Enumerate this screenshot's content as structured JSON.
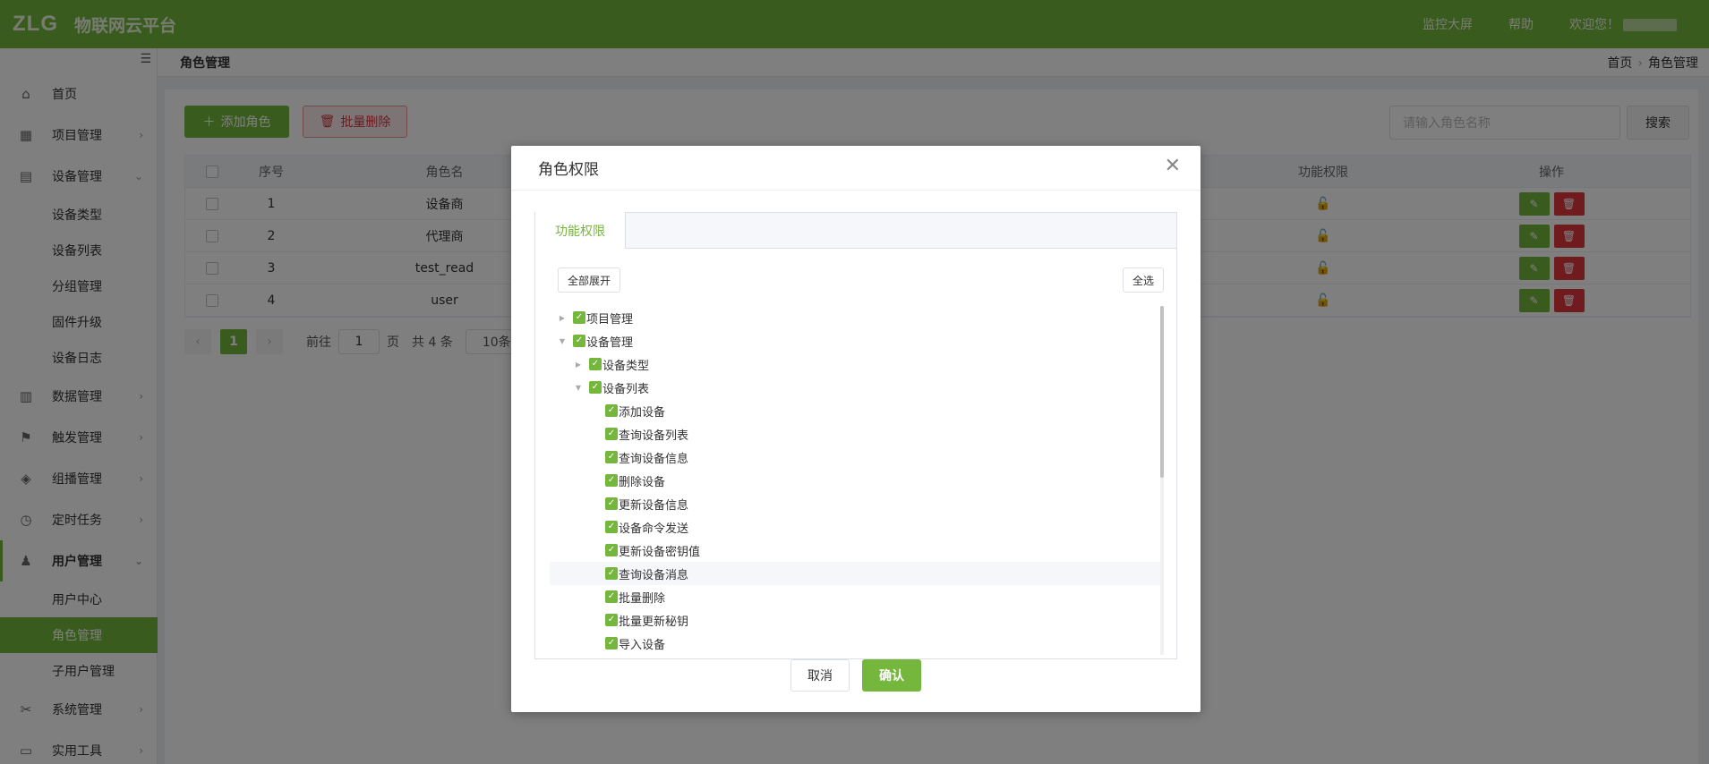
{
  "header": {
    "logo": "ZLG",
    "brand": "物联网云平台",
    "links": [
      "监控大屏",
      "帮助"
    ],
    "welcome": "欢迎您！"
  },
  "sidebar": {
    "items": [
      {
        "label": "首页",
        "icon": "home-icon"
      },
      {
        "label": "项目管理",
        "icon": "dashboard-icon"
      },
      {
        "label": "设备管理",
        "icon": "device-icon",
        "children": [
          "设备类型",
          "设备列表",
          "分组管理",
          "固件升级",
          "设备日志"
        ]
      },
      {
        "label": "数据管理",
        "icon": "chart-icon"
      },
      {
        "label": "触发管理",
        "icon": "flag-icon"
      },
      {
        "label": "组播管理",
        "icon": "layers-icon"
      },
      {
        "label": "定时任务",
        "icon": "clock-icon"
      },
      {
        "label": "用户管理",
        "icon": "user-icon",
        "children": [
          "用户中心",
          "角色管理",
          "子用户管理"
        ]
      },
      {
        "label": "系统管理",
        "icon": "tools-icon"
      },
      {
        "label": "实用工具",
        "icon": "toolbox-icon"
      }
    ]
  },
  "breadcrumb": {
    "title": "角色管理",
    "home": "首页",
    "current": "角色管理"
  },
  "toolbar": {
    "add_label": "添加角色",
    "batch_delete_label": "批量删除",
    "search_placeholder": "请输入角色名称",
    "search_label": "搜索"
  },
  "table": {
    "headers": {
      "no": "序号",
      "name": "角色名",
      "perm": "功能权限",
      "op": "操作"
    },
    "rows": [
      {
        "no": "1",
        "name": "设备商"
      },
      {
        "no": "2",
        "name": "代理商"
      },
      {
        "no": "3",
        "name": "test_read"
      },
      {
        "no": "4",
        "name": "user"
      }
    ]
  },
  "pager": {
    "current": "1",
    "goto_prefix": "前往",
    "goto_value": "1",
    "goto_suffix": "页",
    "total": "共 4 条",
    "size": "10条"
  },
  "dialog": {
    "title": "角色权限",
    "tab": "功能权限",
    "expand_all": "全部展开",
    "select_all": "全选",
    "cancel": "取消",
    "confirm": "确认",
    "tree": [
      {
        "label": "项目管理",
        "level": 0,
        "caret": "right"
      },
      {
        "label": "设备管理",
        "level": 0,
        "caret": "down"
      },
      {
        "label": "设备类型",
        "level": 1,
        "caret": "right"
      },
      {
        "label": "设备列表",
        "level": 1,
        "caret": "down"
      },
      {
        "label": "添加设备",
        "level": 2
      },
      {
        "label": "查询设备列表",
        "level": 2
      },
      {
        "label": "查询设备信息",
        "level": 2
      },
      {
        "label": "删除设备",
        "level": 2
      },
      {
        "label": "更新设备信息",
        "level": 2
      },
      {
        "label": "设备命令发送",
        "level": 2
      },
      {
        "label": "更新设备密钥值",
        "level": 2
      },
      {
        "label": "查询设备消息",
        "level": 2,
        "highlight": true
      },
      {
        "label": "批量删除",
        "level": 2
      },
      {
        "label": "批量更新秘钥",
        "level": 2
      },
      {
        "label": "导入设备",
        "level": 2
      }
    ]
  },
  "colors": {
    "primary": "#75b63c",
    "danger": "#e0393e"
  }
}
